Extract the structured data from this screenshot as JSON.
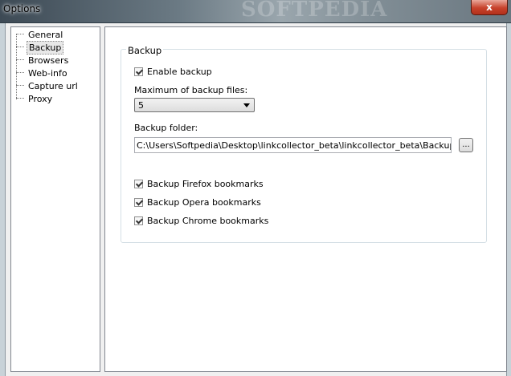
{
  "window": {
    "title": "Options",
    "watermark": "SOFTPEDIA",
    "close_glyph": "x"
  },
  "tree": {
    "items": [
      {
        "label": "General",
        "selected": false
      },
      {
        "label": "Backup",
        "selected": true
      },
      {
        "label": "Browsers",
        "selected": false
      },
      {
        "label": "Web-info",
        "selected": false
      },
      {
        "label": "Capture url",
        "selected": false
      },
      {
        "label": "Proxy",
        "selected": false
      }
    ]
  },
  "backup": {
    "group_title": "Backup",
    "enable_backup": {
      "label": "Enable backup",
      "checked": true
    },
    "max_files_label": "Maximum of backup files:",
    "max_files_value": "5",
    "folder_label": "Backup folder:",
    "folder_value": "C:\\Users\\Softpedia\\Desktop\\linkcollector_beta\\linkcollector_beta\\Backup\\",
    "browse_label": "...",
    "firefox": {
      "label": "Backup Firefox bookmarks",
      "checked": true
    },
    "opera": {
      "label": "Backup Opera bookmarks",
      "checked": true
    },
    "chrome": {
      "label": "Backup Chrome bookmarks",
      "checked": true
    }
  },
  "icons": {
    "close": "close-icon",
    "dropdown": "chevron-down-icon",
    "checkbox": "checkmark-icon"
  }
}
